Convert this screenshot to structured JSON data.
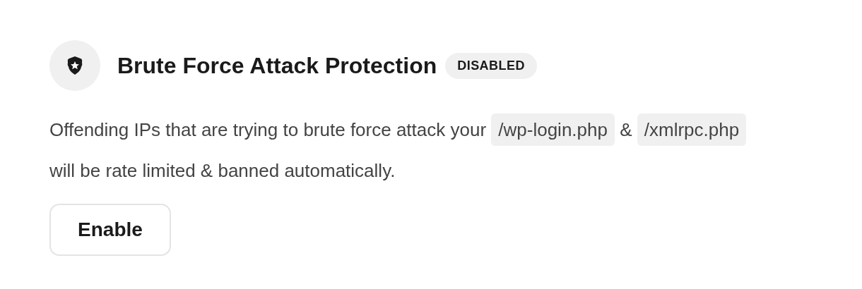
{
  "feature": {
    "title": "Brute Force Attack Protection",
    "status": "DISABLED",
    "description": [
      {
        "kind": "text",
        "text": "Offending IPs that are trying to brute force attack your "
      },
      {
        "kind": "code",
        "text": "/wp-login.php"
      },
      {
        "kind": "text",
        "text": " & "
      },
      {
        "kind": "code",
        "text": "/xmlrpc.php"
      },
      {
        "kind": "text",
        "text": " will be rate limited & banned automatically."
      }
    ],
    "button": "Enable"
  }
}
